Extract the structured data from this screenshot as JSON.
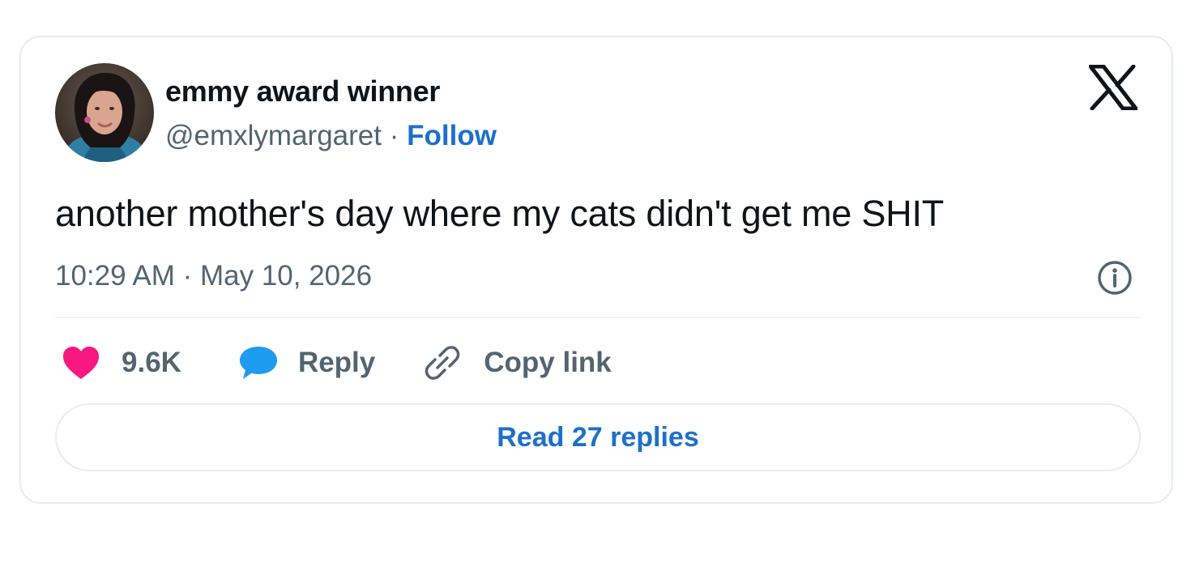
{
  "tweet": {
    "display_name": "emmy award winner",
    "handle": "@emxlymargaret",
    "separator": "·",
    "follow_label": "Follow",
    "text": "another mother's day where my cats didn't get me SHIT",
    "timestamp": "10:29 AM · May 10, 2026",
    "platform_icon": "x-logo-icon",
    "info_icon": "info-icon"
  },
  "actions": {
    "like_count": "9.6K",
    "like_icon": "heart-icon",
    "reply_label": "Reply",
    "reply_icon": "speech-bubble-icon",
    "copy_link_label": "Copy link",
    "copy_link_icon": "link-icon"
  },
  "read_replies_label": "Read 27 replies",
  "colors": {
    "accent": "#1d70c9",
    "like": "#f91880",
    "reply": "#1d9bf0",
    "secondary_text": "#536471",
    "border": "#e6ecf0"
  }
}
